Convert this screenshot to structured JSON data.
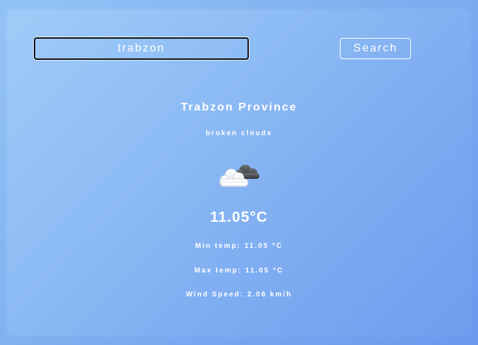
{
  "search": {
    "value": "trabzon",
    "button_label": "Search"
  },
  "weather": {
    "city": "Trabzon Province",
    "description": "broken clouds",
    "icon": "broken-clouds-icon",
    "temperature": "11.05°C",
    "min_temp": "Min temp: 11.05 °C",
    "max_temp": "Max temp: 11.05 °C",
    "wind_speed": "Wind Speed: 2.06 km/h"
  },
  "colors": {
    "background_start": "#93c3f5",
    "background_end": "#6c98ee",
    "text": "#ffffff"
  }
}
